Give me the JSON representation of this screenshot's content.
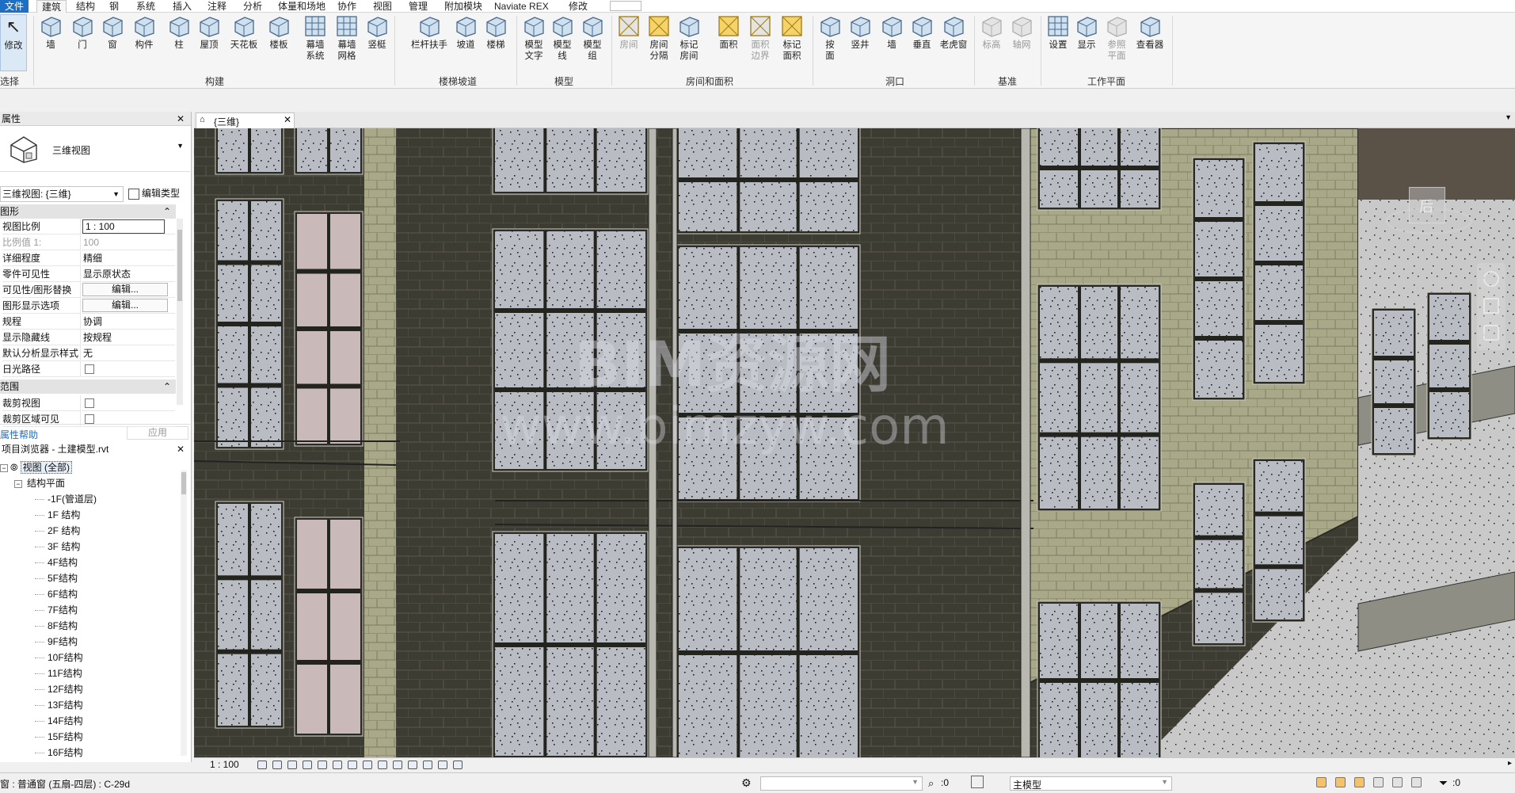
{
  "menu": {
    "tabs": [
      "文件",
      "建筑",
      "结构",
      "钢",
      "系统",
      "插入",
      "注释",
      "分析",
      "体量和场地",
      "协作",
      "视图",
      "管理",
      "附加模块",
      "Naviate REX",
      "修改"
    ],
    "active": "建筑"
  },
  "ribbon": {
    "select": {
      "modify": "修改",
      "select_dropdown": "选择"
    },
    "build": {
      "items": [
        "墙",
        "门",
        "窗",
        "构件",
        "柱",
        "屋顶",
        "天花板",
        "楼板",
        "幕墙\n系统",
        "幕墙\n网格",
        "竖梃"
      ],
      "label": "构建"
    },
    "circulation": {
      "items": [
        "栏杆扶手",
        "坡道",
        "楼梯"
      ],
      "label": "楼梯坡道"
    },
    "model": {
      "items": [
        "模型\n文字",
        "模型\n线",
        "模型\n组"
      ],
      "label": "模型"
    },
    "room": {
      "items": [
        "房间",
        "房间\n分隔",
        "标记\n房间",
        "面积",
        "面积\n边界",
        "标记\n面积"
      ],
      "label": "房间和面积"
    },
    "opening": {
      "items": [
        "按\n面",
        "竖井",
        "墙",
        "垂直",
        "老虎窗"
      ],
      "label": "洞口"
    },
    "datum": {
      "items": [
        "标高",
        "轴网"
      ],
      "label": "基准"
    },
    "workplane": {
      "items": [
        "设置",
        "显示",
        "参照\n平面",
        "查看器"
      ],
      "label": "工作平面"
    }
  },
  "properties": {
    "title": "属性",
    "type_name": "三维视图",
    "instance_selector": "三维视图: {三维}",
    "edit_type": "编辑类型",
    "section_graphics": "图形",
    "rows": [
      {
        "k": "视图比例",
        "v": "1 : 100"
      },
      {
        "k": "比例值 1:",
        "v": "100"
      },
      {
        "k": "详细程度",
        "v": "精细"
      },
      {
        "k": "零件可见性",
        "v": "显示原状态"
      },
      {
        "k": "可见性/图形替换",
        "v": "编辑..."
      },
      {
        "k": "图形显示选项",
        "v": "编辑..."
      },
      {
        "k": "规程",
        "v": "协调"
      },
      {
        "k": "显示隐藏线",
        "v": "按规程"
      },
      {
        "k": "默认分析显示样式",
        "v": "无"
      },
      {
        "k": "日光路径",
        "v": ""
      }
    ],
    "section_extents": "范围",
    "rows2": [
      {
        "k": "裁剪视图",
        "v": ""
      },
      {
        "k": "裁剪区域可见",
        "v": ""
      }
    ],
    "help": "属性帮助",
    "apply": "应用"
  },
  "browser": {
    "title": "项目浏览器 - 土建模型.rvt",
    "root": "视图 (全部)",
    "group": "结构平面",
    "items": [
      "-1F(管道层)",
      "1F 结构",
      "2F 结构",
      "3F 结构",
      "4F结构",
      "5F结构",
      "6F结构",
      "7F结构",
      "8F结构",
      "9F结构",
      "10F结构",
      "11F结构",
      "12F结构",
      "13F结构",
      "14F结构",
      "15F结构",
      "16F结构"
    ]
  },
  "view": {
    "tab_label": "{三维}",
    "watermark_line1": "BIM资源网",
    "watermark_line2": "www.bimzyw.com",
    "scale_label": "1 : 100",
    "viewcube_label": "后"
  },
  "status": {
    "left_text": "窗 : 普通窗 (五扇-四层) : C-29d",
    "select_count": ":0",
    "model_combo": "主模型",
    "filter_count": ":0"
  },
  "colors": {
    "accent": "#1c6fc4",
    "brick_dark": "#3d3c33",
    "brick_light": "#a9a98a",
    "glass": "#b9bcc2",
    "floor": "#c9c9c9"
  }
}
